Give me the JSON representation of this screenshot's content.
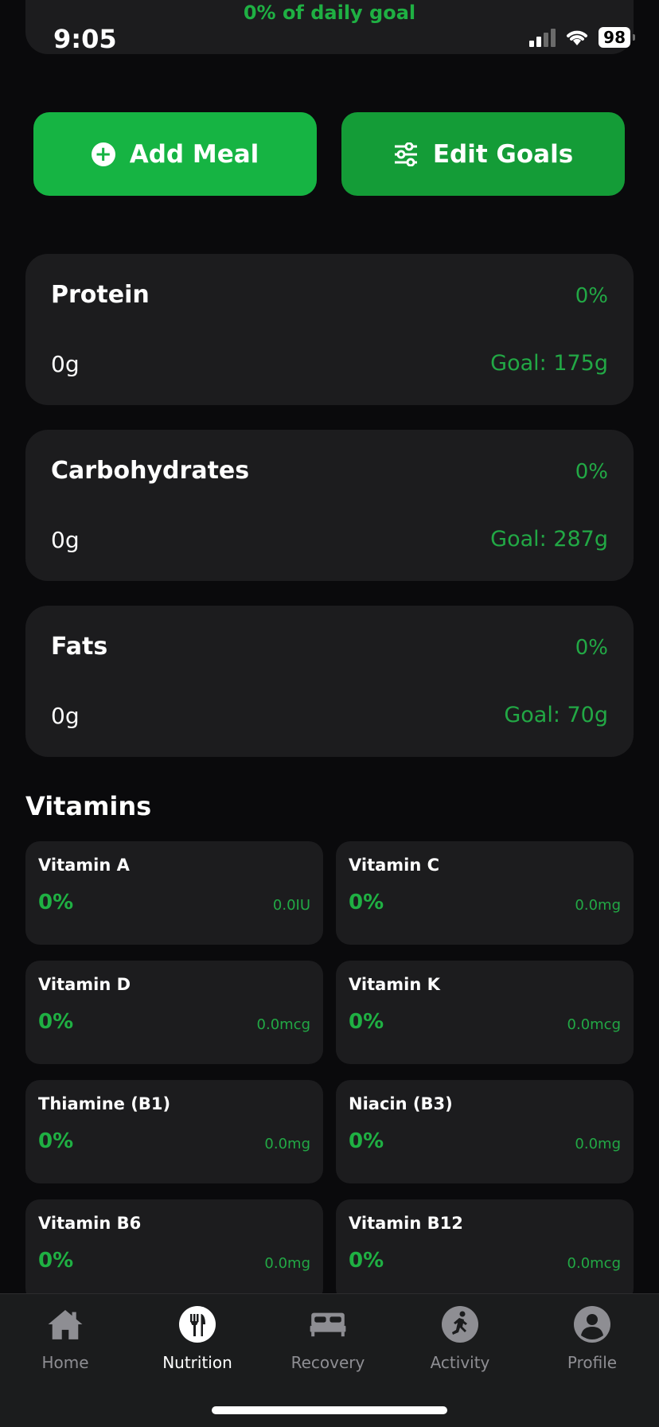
{
  "status_bar": {
    "time": "9:05",
    "battery": "98"
  },
  "header_card": {
    "goal_text": "0% of daily goal"
  },
  "actions": {
    "add_meal": "Add Meal",
    "edit_goals": "Edit Goals"
  },
  "macros": [
    {
      "name": "Protein",
      "percent": "0%",
      "amount": "0g",
      "goal": "Goal: 175g"
    },
    {
      "name": "Carbohydrates",
      "percent": "0%",
      "amount": "0g",
      "goal": "Goal: 287g"
    },
    {
      "name": "Fats",
      "percent": "0%",
      "amount": "0g",
      "goal": "Goal: 70g"
    }
  ],
  "vitamins_title": "Vitamins",
  "vitamins": [
    {
      "name": "Vitamin A",
      "percent": "0%",
      "amount": "0.0IU"
    },
    {
      "name": "Vitamin C",
      "percent": "0%",
      "amount": "0.0mg"
    },
    {
      "name": "Vitamin D",
      "percent": "0%",
      "amount": "0.0mcg"
    },
    {
      "name": "Vitamin K",
      "percent": "0%",
      "amount": "0.0mcg"
    },
    {
      "name": "Thiamine (B1)",
      "percent": "0%",
      "amount": "0.0mg"
    },
    {
      "name": "Niacin (B3)",
      "percent": "0%",
      "amount": "0.0mg"
    },
    {
      "name": "Vitamin B6",
      "percent": "0%",
      "amount": "0.0mg"
    },
    {
      "name": "Vitamin B12",
      "percent": "0%",
      "amount": "0.0mcg"
    }
  ],
  "tabs": [
    {
      "label": "Home",
      "icon": "home-icon"
    },
    {
      "label": "Nutrition",
      "icon": "fork-knife-icon",
      "active": true
    },
    {
      "label": "Recovery",
      "icon": "bed-icon"
    },
    {
      "label": "Activity",
      "icon": "running-icon"
    },
    {
      "label": "Profile",
      "icon": "person-icon"
    }
  ],
  "colors": {
    "accent": "#16b443",
    "accent_dark": "#149c37",
    "card": "#1c1c1e",
    "background": "#0a0a0c"
  }
}
